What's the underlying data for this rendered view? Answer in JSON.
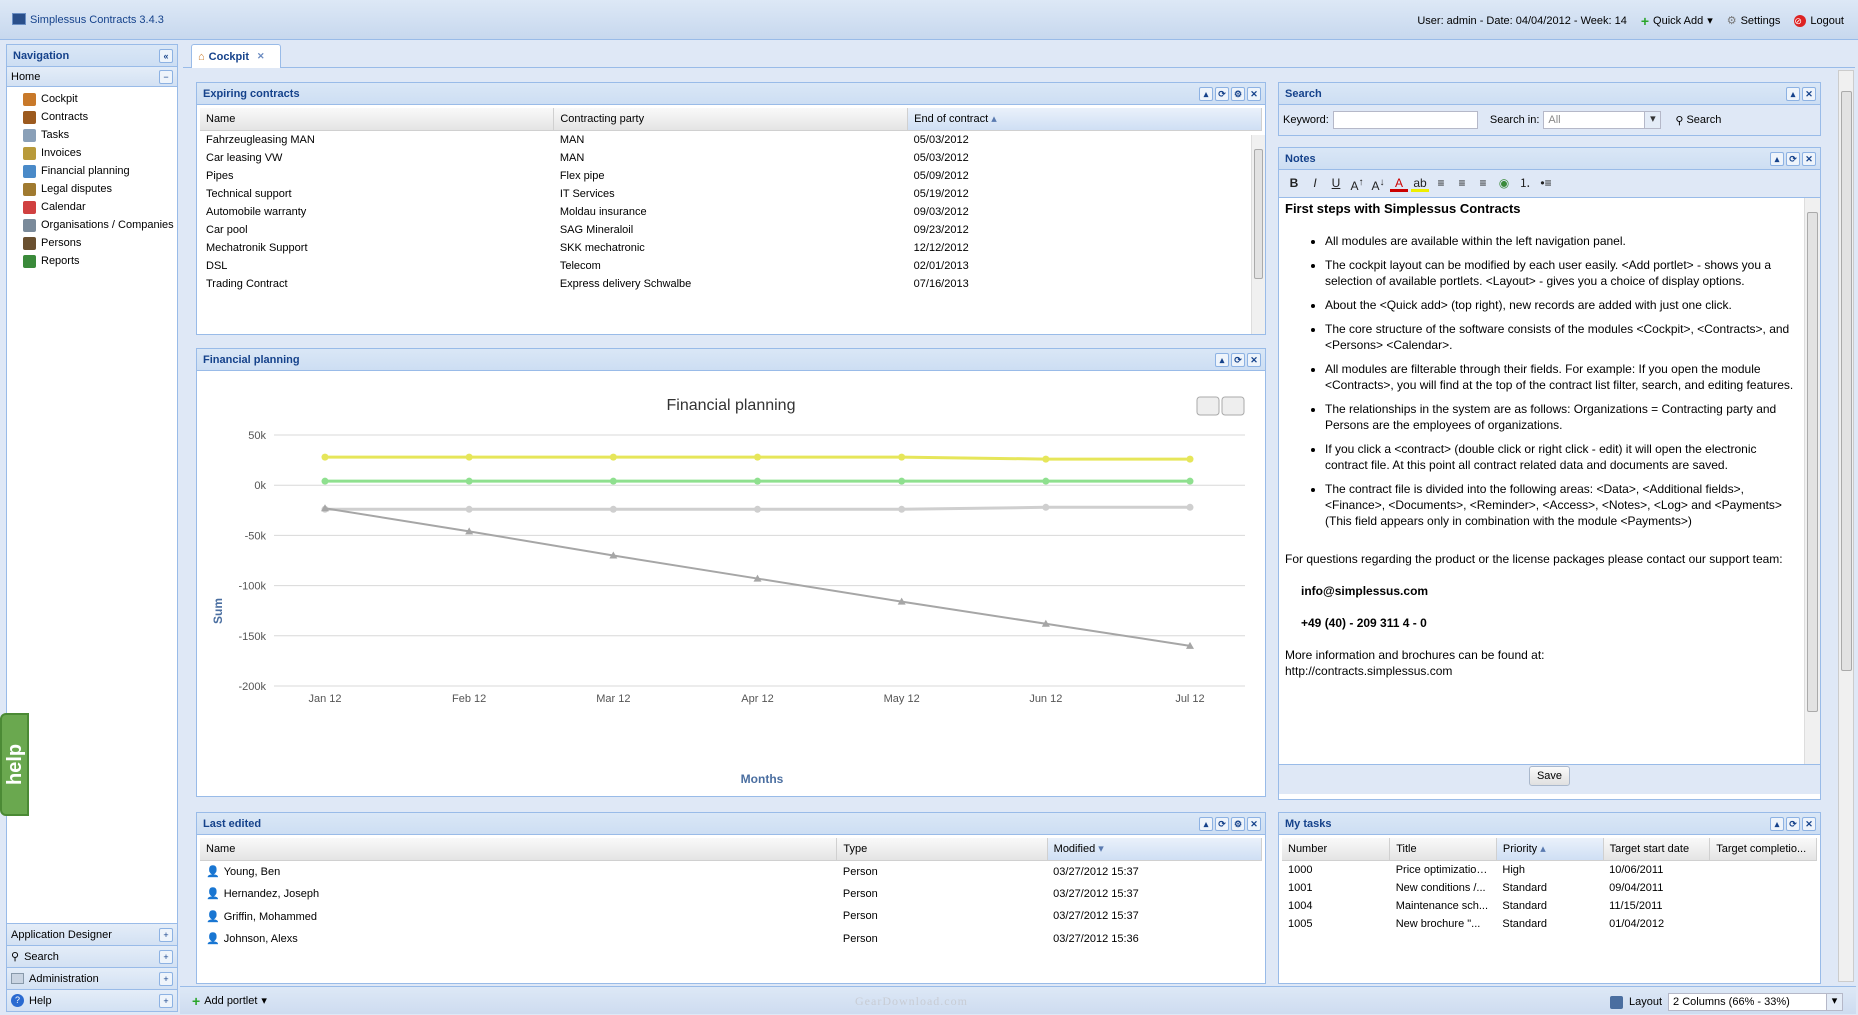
{
  "app": {
    "title": "Simplessus Contracts 3.4.3",
    "user_info": "User: admin - Date: 04/04/2012 - Week: 14",
    "quick_add": "Quick Add",
    "settings": "Settings",
    "logout": "Logout"
  },
  "nav": {
    "title": "Navigation",
    "home": "Home",
    "items": [
      {
        "label": "Cockpit",
        "icon": "home-icon",
        "color": "#c8792a"
      },
      {
        "label": "Contracts",
        "icon": "briefcase-icon",
        "color": "#9c5a1e"
      },
      {
        "label": "Tasks",
        "icon": "tasks-icon",
        "color": "#8aa0b8"
      },
      {
        "label": "Invoices",
        "icon": "coin-icon",
        "color": "#b89a3a"
      },
      {
        "label": "Financial planning",
        "icon": "finance-icon",
        "color": "#4a8ac8"
      },
      {
        "label": "Legal disputes",
        "icon": "scales-icon",
        "color": "#a07a30"
      },
      {
        "label": "Calendar",
        "icon": "calendar-icon",
        "color": "#d04040"
      },
      {
        "label": "Organisations / Companies",
        "icon": "building-icon",
        "color": "#7a8a9a"
      },
      {
        "label": "Persons",
        "icon": "person-icon",
        "color": "#6a5030"
      },
      {
        "label": "Reports",
        "icon": "reports-icon",
        "color": "#3a8a3a"
      }
    ],
    "sections": [
      "Application Designer",
      "Search",
      "Administration",
      "Help"
    ]
  },
  "tab": {
    "label": "Cockpit"
  },
  "expiring": {
    "title": "Expiring contracts",
    "columns": [
      "Name",
      "Contracting party",
      "End of contract"
    ],
    "rows": [
      [
        "Fahrzeugleasing MAN",
        "MAN",
        "05/03/2012"
      ],
      [
        "Car leasing VW",
        "MAN",
        "05/03/2012"
      ],
      [
        "Pipes",
        "Flex pipe",
        "05/09/2012"
      ],
      [
        "Technical support",
        "IT Services",
        "05/19/2012"
      ],
      [
        "Automobile warranty",
        "Moldau insurance",
        "09/03/2012"
      ],
      [
        "Car pool",
        "SAG Mineraloil",
        "09/23/2012"
      ],
      [
        "Mechatronik Support",
        "SKK mechatronic",
        "12/12/2012"
      ],
      [
        "DSL",
        "Telecom",
        "02/01/2013"
      ],
      [
        "Trading Contract",
        "Express delivery Schwalbe",
        "07/16/2013"
      ]
    ]
  },
  "financial": {
    "panel_title": "Financial planning"
  },
  "chart_data": {
    "type": "line",
    "title": "Financial planning",
    "xlabel": "Months",
    "ylabel": "Sum",
    "categories": [
      "Jan 12",
      "Feb 12",
      "Mar 12",
      "Apr 12",
      "May 12",
      "Jun 12",
      "Jul 12"
    ],
    "yticks": [
      "50k",
      "0k",
      "-50k",
      "-100k",
      "-150k",
      "-200k"
    ],
    "ylim": [
      -200000,
      50000
    ],
    "grid": true,
    "series": [
      {
        "values": [
          28000,
          28000,
          28000,
          28000,
          28000,
          26000,
          26000
        ],
        "color": "#e6e65a"
      },
      {
        "values": [
          4000,
          4000,
          4000,
          4000,
          4000,
          4000,
          4000
        ],
        "color": "#8fe08f"
      },
      {
        "values": [
          -24000,
          -24000,
          -24000,
          -24000,
          -24000,
          -22000,
          -22000
        ],
        "color": "#cfcfcf"
      },
      {
        "values": [
          -23000,
          -46000,
          -70000,
          -93000,
          -116000,
          -138000,
          -160000
        ],
        "color": "#a6a6a6"
      }
    ]
  },
  "last_edited": {
    "title": "Last edited",
    "columns": [
      "Name",
      "Type",
      "Modified"
    ],
    "rows": [
      [
        "Young, Ben",
        "Person",
        "03/27/2012 15:37"
      ],
      [
        "Hernandez, Joseph",
        "Person",
        "03/27/2012 15:37"
      ],
      [
        "Griffin, Mohammed",
        "Person",
        "03/27/2012 15:37"
      ],
      [
        "Johnson, Alexs",
        "Person",
        "03/27/2012 15:36"
      ]
    ]
  },
  "search": {
    "title": "Search",
    "keyword_label": "Keyword:",
    "searchin_label": "Search in:",
    "searchin_value": "All",
    "button": "Search"
  },
  "notes": {
    "title": "Notes",
    "heading": "First steps with Simplessus Contracts",
    "bullets": [
      "All modules are available within the left navigation panel.",
      "The cockpit layout can be modified by each user easily. <Add portlet> - shows you a selection of available portlets. <Layout> - gives you a choice of display options.",
      "About the <Quick add> (top right), new records are added with just one click.",
      "The core structure of the software consists of the modules <Cockpit>, <Contracts>, and <Persons> <Calendar>.",
      "All modules are filterable through their fields. For example: If you open the module <Contracts>, you will find at the top of the contract list filter, search, and editing features.",
      "The relationships in the system are as follows: Organizations = Contracting party and Persons are the employees of organizations.",
      "If you click a <contract> (double click or right click - edit) it will open the electronic contract file. At this point all contract related data and documents are saved.",
      "The contract file is divided into the following areas: <Data>, <Additional fields>, <Finance>, <Documents>, <Reminder>, <Access>, <Notes>, <Log> and <Payments> (This field appears only in combination with the module <Payments>)"
    ],
    "contact_text": "For questions regarding the product or the license packages please contact our support team:",
    "email": "info@simplessus.com",
    "phone": "+49 (40) - 209 311 4 - 0",
    "more_info": "More information and brochures can be found at:",
    "url": "http://contracts.simplessus.com",
    "save": "Save"
  },
  "tasks": {
    "title": "My tasks",
    "columns": [
      "Number",
      "Title",
      "Priority",
      "Target start date",
      "Target completio..."
    ],
    "rows": [
      [
        "1000",
        "Price optimization...",
        "High",
        "10/06/2011",
        ""
      ],
      [
        "1001",
        "New conditions /...",
        "Standard",
        "09/04/2011",
        ""
      ],
      [
        "1004",
        "Maintenance sch...",
        "Standard",
        "11/15/2011",
        ""
      ],
      [
        "1005",
        "New brochure \"...",
        "Standard",
        "01/04/2012",
        ""
      ]
    ]
  },
  "bottom": {
    "add_portlet": "Add portlet",
    "layout_label": "Layout",
    "layout_value": "2 Columns (66% - 33%)",
    "watermark": "GearDownload.com"
  },
  "help_tab": "help"
}
